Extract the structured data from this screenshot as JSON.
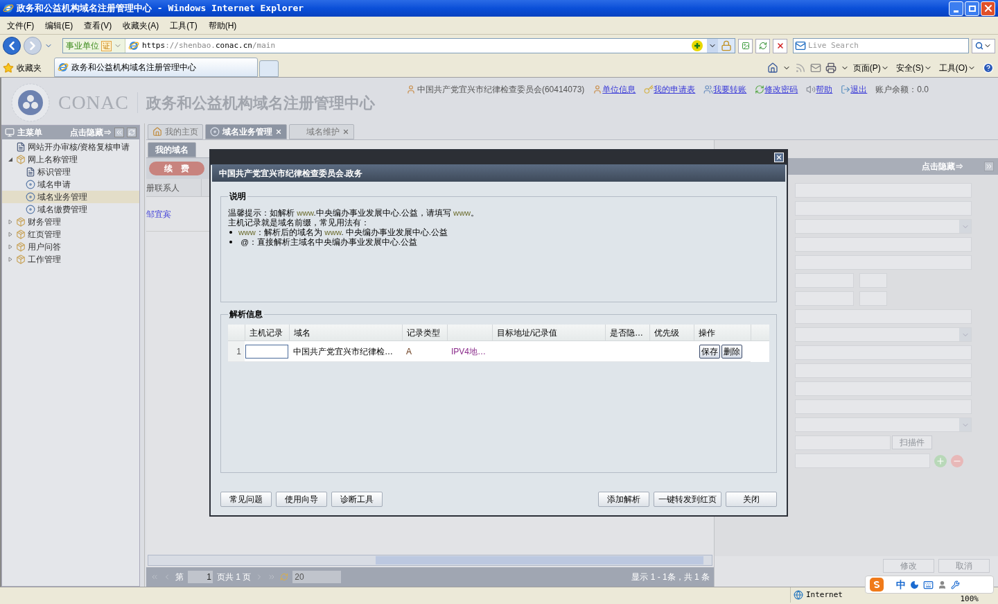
{
  "window": {
    "title": "政务和公益机构域名注册管理中心 - Windows Internet Explorer"
  },
  "menu": [
    "文件(F)",
    "编辑(E)",
    "查看(V)",
    "收藏夹(A)",
    "工具(T)",
    "帮助(H)"
  ],
  "address_bar": {
    "site_label": "事业单位",
    "badge": "证",
    "url_scheme": "https",
    "url_sep": "://",
    "url_host": "shenbao.",
    "url_domain": "conac.cn",
    "url_path": "/main"
  },
  "search": {
    "placeholder": "Live Search"
  },
  "favorites": {
    "label": "收藏夹"
  },
  "browser_tabs": [
    {
      "title": "政务和公益机构域名注册管理中心",
      "selected": true
    }
  ],
  "command_bar": [
    "页面(P)",
    "安全(S)",
    "工具(O)"
  ],
  "header": {
    "logo_text": "CONAC",
    "site_title": "政务和公益机构域名注册管理中心",
    "user": "中国共产党宜兴市纪律检查委员会(60414073)",
    "links": [
      {
        "label": "单位信息",
        "kind": "user"
      },
      {
        "label": "我的申请表",
        "kind": "key"
      },
      {
        "label": "我要转账",
        "kind": "users"
      },
      {
        "label": "修改密码",
        "kind": "refresh"
      },
      {
        "label": "帮助",
        "kind": "speaker"
      },
      {
        "label": "退出",
        "kind": "exit"
      }
    ],
    "balance": "账户余额：0.0"
  },
  "sidebar": {
    "title": "主菜单",
    "hide": "点击隐藏⇒",
    "items": [
      {
        "label": "网站开办审核/资格复核申请",
        "kind": "doc",
        "selected": false
      },
      {
        "label": "网上名称管理",
        "kind": "folder",
        "expanded": true,
        "selected": false,
        "children": [
          {
            "label": "标识管理",
            "kind": "doc",
            "selected": false
          },
          {
            "label": "域名申请",
            "kind": "disk",
            "selected": false
          },
          {
            "label": "域名业务管理",
            "kind": "disk",
            "selected": true
          },
          {
            "label": "域名缴费管理",
            "kind": "disk",
            "selected": false
          }
        ]
      },
      {
        "label": "财务管理",
        "kind": "folder",
        "expanded": false,
        "selected": false
      },
      {
        "label": "红页管理",
        "kind": "folder",
        "expanded": false,
        "selected": false
      },
      {
        "label": "用户问答",
        "kind": "folder",
        "expanded": false,
        "selected": false
      },
      {
        "label": "工作管理",
        "kind": "folder",
        "expanded": false,
        "selected": false
      }
    ]
  },
  "page_tabs": [
    {
      "label": "我的主页",
      "kind": "home",
      "selected": false,
      "closable": false
    },
    {
      "label": "域名业务管理",
      "kind": "disk",
      "selected": true,
      "closable": true
    },
    {
      "label": "域名维护",
      "kind": "plain",
      "selected": false,
      "closable": true
    }
  ],
  "sub_tabs": [
    {
      "label": "我的域名",
      "selected": true
    }
  ],
  "grid": {
    "renew_button": "续　费",
    "column": "册联系人",
    "cell": "邹宜宾"
  },
  "pager": {
    "page_label": "第",
    "page": "1",
    "total": "页共 1 页",
    "page_size": "20",
    "summary": "显示 1 - 1条，共 1 条"
  },
  "right_panel": {
    "hide": "点击隐藏⇒",
    "scan_button": "扫描件",
    "buttons": [
      "修改",
      "取消"
    ]
  },
  "dialog": {
    "title": "中国共产党宜兴市纪律检查委员会.政务",
    "notes_legend": "说明",
    "notes": [
      {
        "kind": "line",
        "segments": [
          {
            "text": "温馨提示：如解析 ",
            "highlight": false
          },
          {
            "text": "www",
            "highlight": true
          },
          {
            "text": ".中央编办事业发展中心.公益，请填写 ",
            "highlight": false
          },
          {
            "text": "www",
            "highlight": true
          },
          {
            "text": "。",
            "highlight": false
          }
        ]
      },
      {
        "kind": "line",
        "segments": [
          {
            "text": "主机记录就是域名前缀，常见用法有：",
            "highlight": false
          }
        ]
      },
      {
        "kind": "bullet",
        "segments": [
          {
            "text": "www",
            "highlight": true
          },
          {
            "text": "：解析后的域名为 ",
            "highlight": false
          },
          {
            "text": "www",
            "highlight": true
          },
          {
            "text": ". 中央编办事业发展中心.公益",
            "highlight": false
          }
        ]
      },
      {
        "kind": "bullet",
        "segments": [
          {
            "text": " @：直接解析主域名中央编办事业发展中心.公益",
            "highlight": false
          }
        ]
      }
    ],
    "records_legend": "解析信息",
    "columns": [
      {
        "label": "主机记录"
      },
      {
        "label": "域名"
      },
      {
        "label": "记录类型"
      },
      {
        "label": "目标地址/记录值"
      },
      {
        "label": "是否隐…"
      },
      {
        "label": "优先级"
      },
      {
        "label": "操作"
      }
    ],
    "rows": [
      {
        "number": "1",
        "domain": "中国共产党宜兴市纪律检…",
        "type": "A",
        "line": "IPV4地…",
        "actions": [
          "保存",
          "删除"
        ]
      }
    ],
    "left_buttons": [
      "常见问题",
      "使用向导",
      "诊断工具"
    ],
    "right_buttons": [
      "添加解析",
      "一键转发到红页",
      "关闭"
    ]
  },
  "status_bar": {
    "zone": "Internet",
    "zoom": "100%"
  },
  "ime": {
    "mode": "中"
  }
}
